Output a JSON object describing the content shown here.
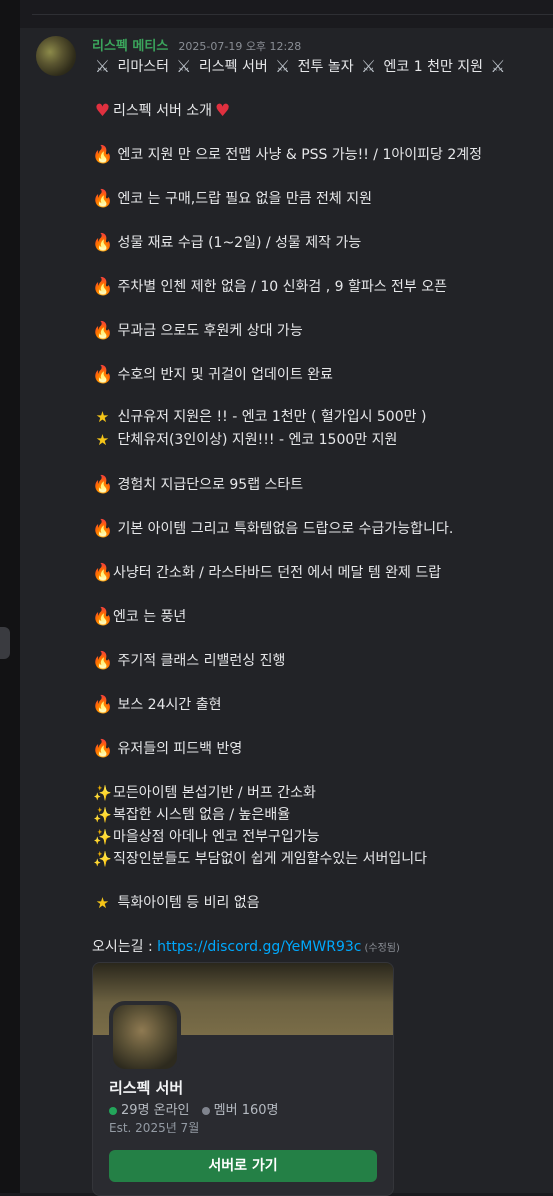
{
  "message": {
    "author": "리스펙 메티스",
    "timestamp": "2025-07-19 오후 12:28",
    "lines": {
      "title_text": [
        " 리마스터 ",
        " 리스펙 서버 ",
        " 전투 놀자 ",
        " 엔코 1 천만 지원 "
      ],
      "intro": "리스펙 서버 소개",
      "f1": "엔코 지원 만 으로 전맵 사냥 & PSS 가능!! /  1아이피당 2계정",
      "f2": "엔코 는 구매,드랍 필요 없을 만큼 전체 지원",
      "f3": "성물 재료 수급 (1~2일)  / 성물 제작 가능",
      "f4": "주차별 인첸 제한 없음 / 10 신화검 , 9 할파스  전부 오픈",
      "f5": "무과금 으로도 후원케 상대 가능",
      "f6": "수호의 반지 및 귀걸이 업데이트 완료",
      "s1": "신규유저 지원은  !! - 엔코 1천만 ( 혈가입시 500만 )",
      "s2": "단체유저(3인이상) 지원!!! - 엔코 1500만 지원",
      "f7": "경험치 지급단으로 95랩 스타트",
      "f8": "기본 아이템 그리고 특화템없음 드랍으로 수급가능합니다.",
      "f9": "사냥터 간소화 / 라스타바드 던전 에서 메달 템 완제 드랍",
      "f10": "엔코 는 풍년",
      "f11": "주기적 클래스 리밸런싱 진행",
      "f12": "보스 24시간 출현",
      "f13": "유저들의 피드백 반영",
      "sp1": "모든아이템 본섭기반 / 버프 간소화",
      "sp2": "복잡한 시스템 없음 / 높은배율",
      "sp3": "마을상점 아데나 엔코 전부구입가능",
      "sp4": "직장인분들도 부담없이 쉽게 게임할수있는 서버입니다",
      "s3": "특화아이템 등 비리 없음",
      "link_label": "오시는길 : ",
      "link_url": "https://discord.gg/YeMWR93c",
      "edited": "(수정됨)"
    }
  },
  "invite": {
    "server_name": "리스펙 서버",
    "online": "29명 온라인",
    "members": "멤버 160명",
    "established": "Est. 2025년 7월",
    "join_label": "서버로 가기"
  },
  "icons": {
    "sword": "crossed-swords-icon",
    "heart": "heart-icon",
    "fire": "fire-icon",
    "star": "star-icon",
    "sparkle": "sparkles-icon"
  },
  "colors": {
    "username": "#3ba55c",
    "link": "#00a8fc",
    "online_dot": "#23a55a",
    "members_dot": "#80848e",
    "join_button": "#248046"
  }
}
